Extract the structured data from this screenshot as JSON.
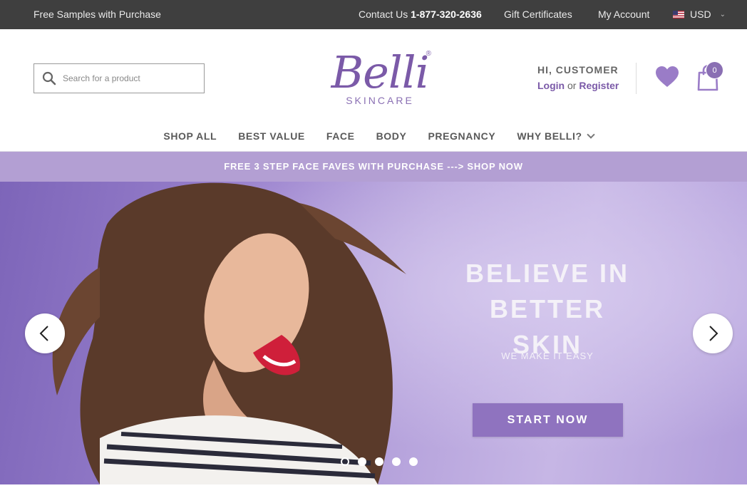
{
  "topbar": {
    "promo": "Free Samples with Purchase",
    "contact_prefix": "Contact Us",
    "phone": "1-877-320-2636",
    "gift": "Gift Certificates",
    "account": "My Account",
    "currency": "USD"
  },
  "search": {
    "placeholder": "Search for a product"
  },
  "logo": {
    "brand": "Belli",
    "sub": "SKINCARE",
    "reg": "®"
  },
  "user": {
    "greeting": "HI, CUSTOMER",
    "login": "Login",
    "or": "or",
    "register": "Register"
  },
  "cart": {
    "count": "0"
  },
  "nav": {
    "items": [
      {
        "label": "SHOP ALL"
      },
      {
        "label": "BEST VALUE"
      },
      {
        "label": "FACE"
      },
      {
        "label": "BODY"
      },
      {
        "label": "PREGNANCY"
      },
      {
        "label": "WHY BELLI?"
      }
    ]
  },
  "promo_banner": {
    "text": "FREE 3 STEP FACE FAVES WITH PURCHASE ---> SHOP NOW"
  },
  "hero": {
    "headline_line1": "BELIEVE IN BETTER",
    "headline_line2": "SKIN",
    "tagline": "WE MAKE IT EASY",
    "cta": "START NOW",
    "slide_count": 5,
    "active_slide": 1
  },
  "colors": {
    "brand": "#7b5aa8",
    "topbar": "#3f3f3f",
    "promo": "#b39fd3",
    "cta": "#8f73bf"
  }
}
